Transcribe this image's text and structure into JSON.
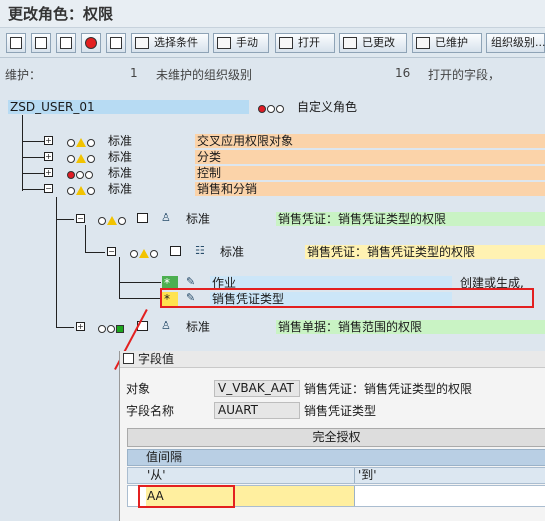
{
  "title": "更改角色：权限",
  "toolbar": {
    "buttons": [
      {
        "label": "选择条件",
        "icon": "selection-icon"
      },
      {
        "label": "手动",
        "icon": "manual-icon"
      },
      {
        "label": "打开",
        "icon": "open-icon"
      },
      {
        "label": "已更改",
        "icon": "changed-icon"
      },
      {
        "label": "已维护",
        "icon": "maintained-icon"
      },
      {
        "label": "组织级别...",
        "icon": "org-level-icon"
      }
    ],
    "icon_buttons": [
      "save-icon",
      "back-icon",
      "profile-icon",
      "stop-icon",
      "delete-icon"
    ]
  },
  "status": {
    "maintain_label": "维护：",
    "org_count": "1",
    "org_text": "未维护的组织级别",
    "field_count": "16",
    "field_text": "打开的字段，"
  },
  "tree": {
    "root_name": "ZSD_USER_01",
    "root_desc": "自定义角色",
    "level1": [
      {
        "std": "标准",
        "desc": "交叉应用权限对象"
      },
      {
        "std": "分类",
        "desc": "分类"
      },
      {
        "std": "标准",
        "desc": "控制"
      },
      {
        "std": "标准",
        "desc": "销售和分销"
      }
    ],
    "level1_std": [
      "标准",
      "标准",
      "标准",
      "标准"
    ],
    "level1_desc": [
      "交叉应用权限对象",
      "分类",
      "控制",
      "销售和分销"
    ],
    "sales_doc": {
      "std": "标准",
      "desc": "销售凭证：销售凭证类型的权限"
    },
    "sales_doc_child": {
      "std": "标准",
      "desc": "销售凭证：销售凭证类型的权限"
    },
    "fields": [
      {
        "marker": "*",
        "label": "作业",
        "value": "创建或生成,"
      },
      {
        "marker": "*",
        "label": "销售凭证类型",
        "value": ""
      }
    ],
    "sales_org": {
      "std": "标准",
      "desc": "销售单据：销售范围的权限"
    }
  },
  "dialog": {
    "title": "字段值",
    "object_label": "对象",
    "object_value": "V_VBAK_AAT",
    "object_desc": "销售凭证：销售凭证类型的权限",
    "field_label": "字段名称",
    "field_value": "AUART",
    "field_desc": "销售凭证类型",
    "full_auth": "完全授权",
    "interval_label": "值间隔",
    "col_from": "'从'",
    "col_to": "'到'",
    "row_from": "AA",
    "row_to": ""
  }
}
